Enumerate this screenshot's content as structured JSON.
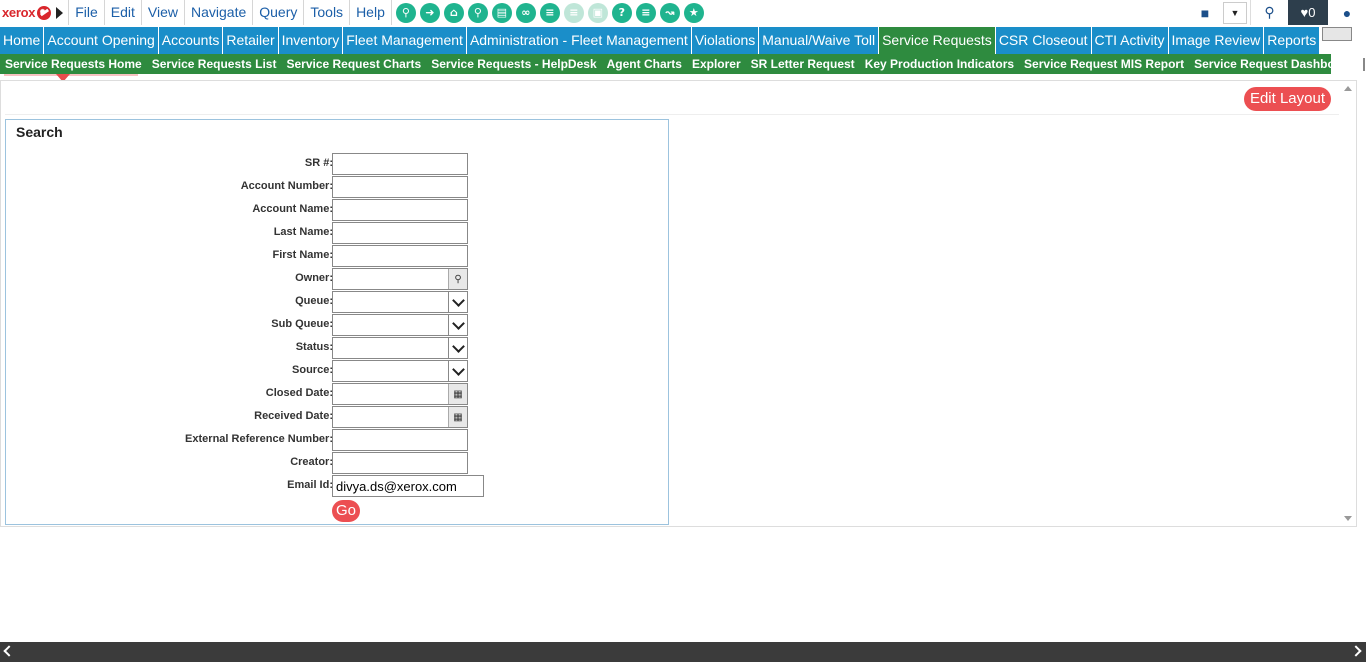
{
  "app": {
    "logo_text": "xerox",
    "brand_color": "#d9262c",
    "accent_green": "#2e8b3f",
    "accent_blue": "#1a8ec9",
    "button_red": "#ec4f52"
  },
  "topmenu": {
    "items": [
      "File",
      "Edit",
      "View",
      "Navigate",
      "Query",
      "Tools",
      "Help"
    ],
    "tool_icons": [
      "search-icon",
      "go-icon",
      "home-icon",
      "key-icon",
      "clipboard-icon",
      "link-icon",
      "list-icon",
      "doc-icon",
      "print-icon",
      "help-icon",
      "notes-icon",
      "chart-icon",
      "star-icon"
    ],
    "notification_count": "0"
  },
  "mainnav": {
    "items": [
      "Home",
      "Account Opening",
      "Accounts",
      "Retailer",
      "Inventory",
      "Fleet Management",
      "Administration - Fleet Management",
      "Violations",
      "Manual/Waive Toll",
      "Service Requests",
      "CSR Closeout",
      "CTI Activity",
      "Image Review",
      "Reports"
    ],
    "active": "Service Requests"
  },
  "subnav": {
    "items": [
      "Service Requests Home",
      "Service Requests List",
      "Service Request Charts",
      "Service Requests - HelpDesk",
      "Agent Charts",
      "Explorer",
      "SR Letter Request",
      "Key Production Indicators",
      "Service Request MIS Report",
      "Service Request Dashboard"
    ],
    "active": "Service Requests Home"
  },
  "header": {
    "edit_layout": "Edit Layout"
  },
  "search": {
    "title": "Search",
    "fields": [
      {
        "label": "SR #:",
        "value": "",
        "type": "text"
      },
      {
        "label": "Account Number:",
        "value": "",
        "type": "text"
      },
      {
        "label": "Account Name:",
        "value": "",
        "type": "text"
      },
      {
        "label": "Last Name:",
        "value": "",
        "type": "text"
      },
      {
        "label": "First Name:",
        "value": "",
        "type": "text"
      },
      {
        "label": "Owner:",
        "value": "",
        "type": "lookup"
      },
      {
        "label": "Queue:",
        "value": "",
        "type": "select"
      },
      {
        "label": "Sub Queue:",
        "value": "",
        "type": "select"
      },
      {
        "label": "Status:",
        "value": "",
        "type": "select"
      },
      {
        "label": "Source:",
        "value": "",
        "type": "select"
      },
      {
        "label": "Closed Date:",
        "value": "",
        "type": "date"
      },
      {
        "label": "Received Date:",
        "value": "",
        "type": "date"
      },
      {
        "label": "External Reference Number:",
        "value": "",
        "type": "text"
      },
      {
        "label": "Creator:",
        "value": "",
        "type": "text"
      },
      {
        "label": "Email Id:",
        "value": "divya.ds@xerox.com",
        "type": "email"
      }
    ],
    "go_label": "Go"
  }
}
